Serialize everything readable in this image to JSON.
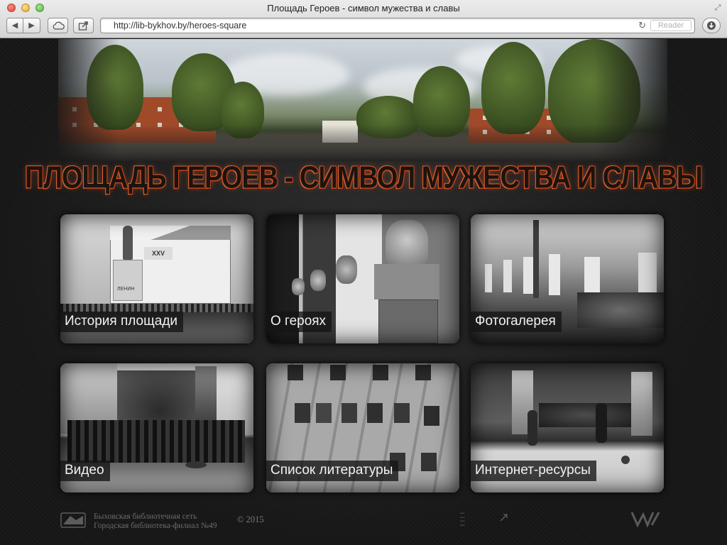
{
  "window": {
    "title": "Площадь Героев - символ мужества и славы",
    "address": "http://lib-bykhov.by/heroes-square",
    "reader_label": "Reader"
  },
  "toolbar_icons": {
    "back": "chevron-left-icon",
    "forward": "chevron-right-icon",
    "cloud": "cloud-icon",
    "share": "share-icon",
    "reload": "reload-icon",
    "download": "download-icon",
    "fullscreen": "fullscreen-icon"
  },
  "page": {
    "title": "ПЛОЩАДЬ ГЕРОЕВ - СИМВОЛ МУЖЕСТВА И СЛАВЫ",
    "colors": {
      "background": "#161616",
      "title_outline": "#d2542a",
      "label_background": "#141414"
    },
    "tiles": [
      {
        "label": "История площади"
      },
      {
        "label": "О героях"
      },
      {
        "label": "Фотогалерея"
      },
      {
        "label": "Видео"
      },
      {
        "label": "Список литературы"
      },
      {
        "label": "Интернет-ресурсы"
      }
    ],
    "photo_text": {
      "banner": "XXV",
      "building_sign": "ЛЕНИН"
    }
  },
  "footer": {
    "org_line1": "Быховская библиотечная сеть",
    "org_line2": "Городская библиотека-филиал №49",
    "copyright": "© 2015"
  }
}
